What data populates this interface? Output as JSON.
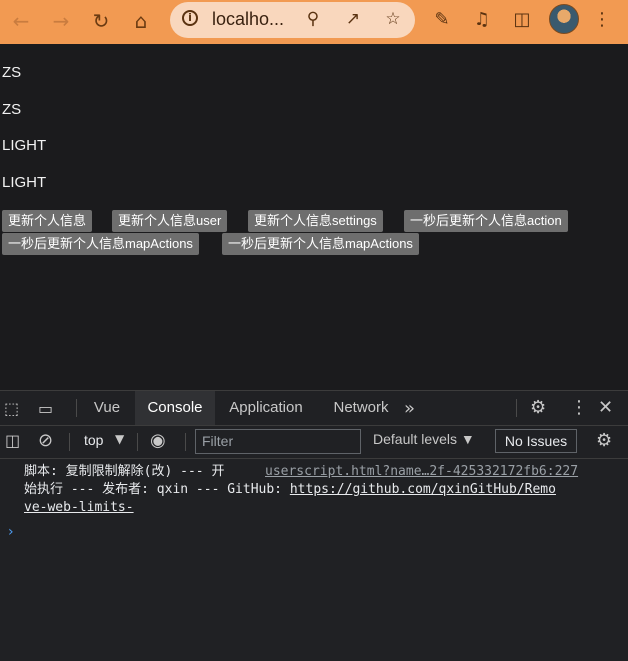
{
  "browser": {
    "url": "localho...",
    "icons": [
      "back-icon",
      "forward-icon",
      "reload-icon",
      "home-icon",
      "info-icon",
      "zoom-icon",
      "share-icon",
      "star-icon",
      "extensions-icon",
      "media-icon",
      "sidepanel-icon",
      "avatar",
      "menu-icon"
    ]
  },
  "page": {
    "lines": [
      "ZS",
      "ZS",
      "LIGHT",
      "LIGHT"
    ],
    "buttons": [
      "更新个人信息",
      "更新个人信息user",
      "更新个人信息settings",
      "一秒后更新个人信息action",
      "一秒后更新个人信息mapActions",
      "一秒后更新个人信息mapActions"
    ]
  },
  "devtools": {
    "tabs": [
      "Vue",
      "Console",
      "Application",
      "Network"
    ],
    "active_tab": "Console",
    "context": "top",
    "filter_placeholder": "Filter",
    "levels": "Default levels ▼",
    "issues": "No Issues",
    "log": {
      "line1": "脚本: 复制限制解除(改) --- 开",
      "source": "userscript.html?name…2f-425332172fb6:227",
      "line2_prefix": "始执行 --- 发布者: qxin --- GitHub: ",
      "link1": "https://github.com/qxinGitHub/Remo",
      "link2": "ve-web-limits-"
    }
  },
  "colors": {
    "titlebar": "#f29a52",
    "page_bg": "#1b1b1d",
    "button_bg": "#6e6e6e",
    "devtools_bg": "#202124"
  }
}
